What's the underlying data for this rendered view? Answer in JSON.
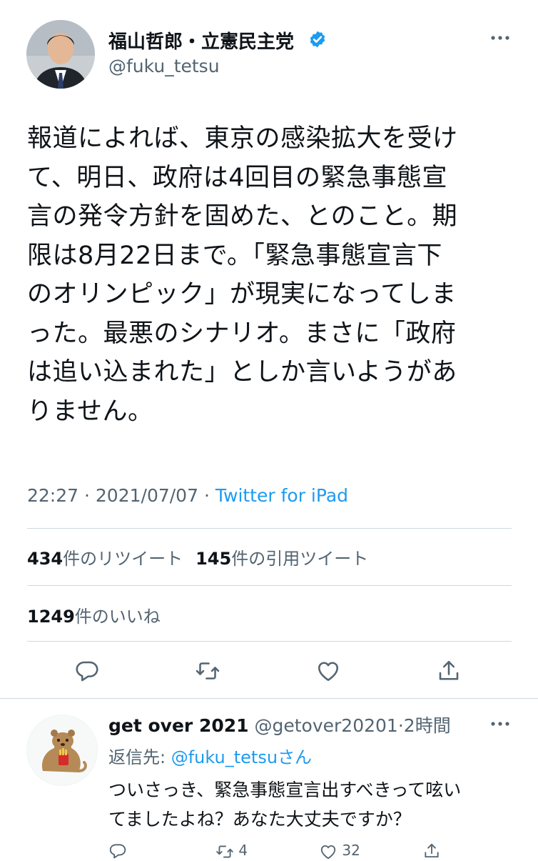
{
  "author": {
    "display_name": "福山哲郎・立憲民主党",
    "handle": "@fuku_tetsu",
    "verified": true,
    "avatar": "politician-portrait"
  },
  "tweet": {
    "lines": [
      "報道によれば、東京の感染拡大を受け",
      "て、明日、政府は4回目の緊急事態宣",
      "言の発令方針を固めた、とのこと。期",
      "限は8月22日まで。「緊急事態宣言下",
      "のオリンピック」が現実になってしま",
      "った。最悪のシナリオ。まさに「政府",
      "は追い込まれた」としか言いようがあ",
      "りません。"
    ],
    "time": "22:27",
    "date": "2021/07/07",
    "separator": "·",
    "source": "Twitter for iPad"
  },
  "stats": {
    "retweets_count": "434",
    "retweets_label": "件のリツイート",
    "quotes_count": "145",
    "quotes_label": "件の引用ツイート",
    "likes_count": "1249",
    "likes_label": "件のいいね"
  },
  "actions": [
    "reply-icon",
    "retweet-icon",
    "like-icon",
    "share-icon"
  ],
  "reply": {
    "display_name": "get over 2021",
    "handle": "@getover20201",
    "separator": "·",
    "time": "2時間",
    "reply_to_prefix": "返信先: ",
    "reply_to_handle": "@fuku_tetsu",
    "reply_to_suffix": "さん",
    "lines": [
      "ついさっき、緊急事態宣言出すべきって呟い",
      "てましたよね？あなた大丈夫ですか？"
    ],
    "retweet_count": "4",
    "like_count": "32",
    "avatar": "quokka-illustration"
  },
  "colors": {
    "text": "#0f1419",
    "secondary": "#536471",
    "accent": "#1d9bf0",
    "divider": "#cfd9de"
  }
}
